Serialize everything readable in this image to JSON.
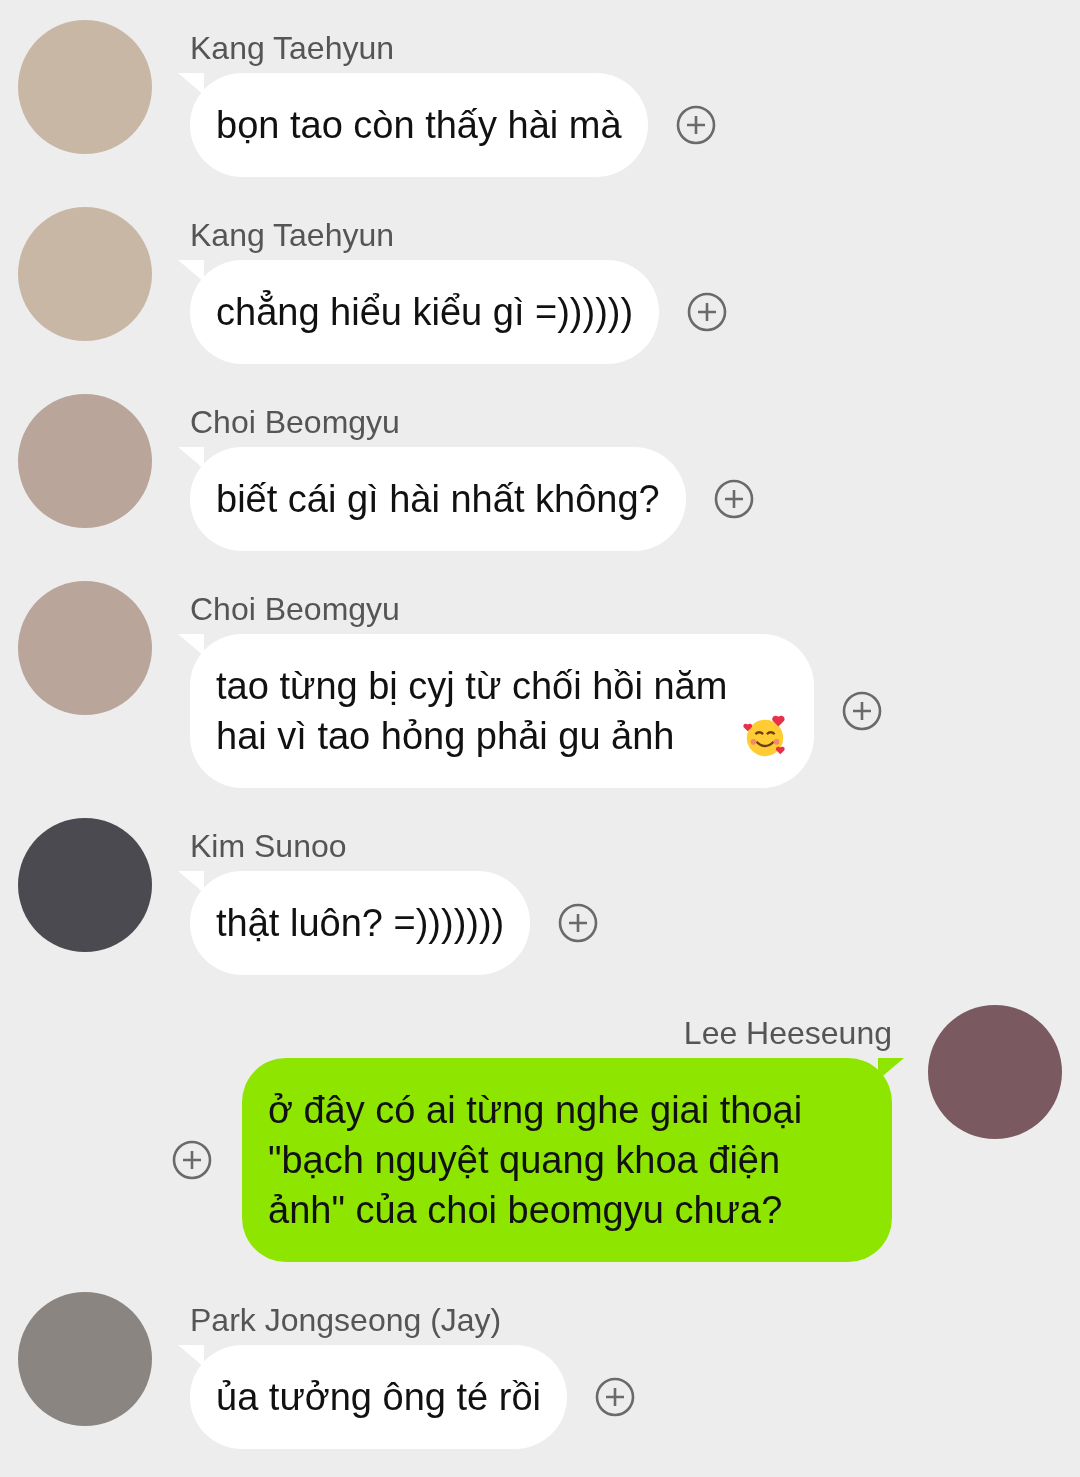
{
  "messages": [
    {
      "kind": "incoming",
      "sender": "Kang Taehyun",
      "text": "bọn tao còn thấy hài mà"
    },
    {
      "kind": "incoming",
      "sender": "Kang Taehyun",
      "text": "chẳng hiểu kiểu gì =))))))"
    },
    {
      "kind": "incoming",
      "sender": "Choi Beomgyu",
      "text": "biết cái gì hài nhất không?"
    },
    {
      "kind": "incoming",
      "sender": "Choi Beomgyu",
      "text": "tao từng bị cyj từ chối hồi năm hai vì tao hỏng phải gu ảnh",
      "has_emoji": true
    },
    {
      "kind": "incoming",
      "sender": "Kim Sunoo",
      "text": "thật luôn? =)))))))"
    },
    {
      "kind": "outgoing",
      "sender": "Lee Heeseung",
      "text": "ở đây có ai từng nghe giai thoại \"bạch nguyệt quang khoa điện ảnh\" của choi beomgyu chưa?"
    },
    {
      "kind": "incoming",
      "sender": "Park Jongseong (Jay)",
      "text": "ủa tưởng ông té rồi"
    }
  ]
}
